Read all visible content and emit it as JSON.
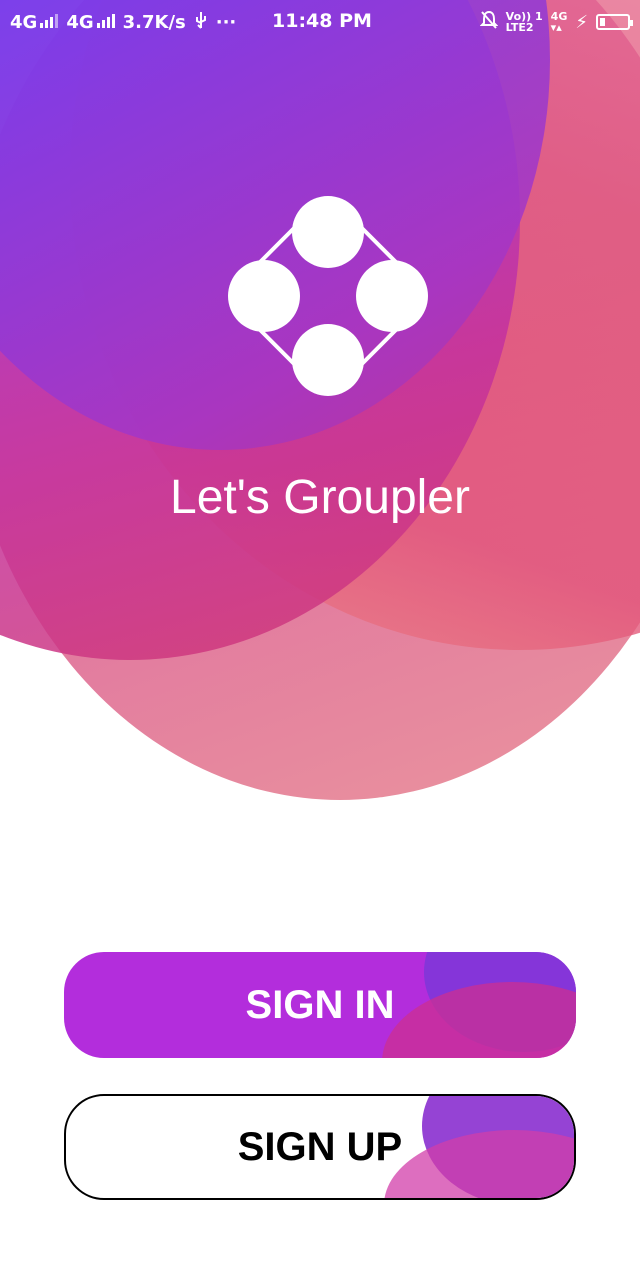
{
  "status_bar": {
    "sim1": "4G",
    "sim2": "4G",
    "speed": "3.7K/s",
    "usb_icon": "usb-icon",
    "more": "···",
    "time": "11:48 PM",
    "volte_top": "Vo)) 1",
    "volte_bottom": "LTE2",
    "net_top": "4G",
    "net_bottom": "▾▴",
    "charge_icon": "⚡"
  },
  "app": {
    "title": "Let's Groupler",
    "logo_icon": "groupler-logo-icon"
  },
  "actions": {
    "sign_in": "SIGN IN",
    "sign_up": "SIGN UP"
  },
  "colors": {
    "primary_purple": "#b32ddc",
    "blue_violet": "#5a44ff",
    "pink": "#e15a7c",
    "white": "#ffffff"
  }
}
